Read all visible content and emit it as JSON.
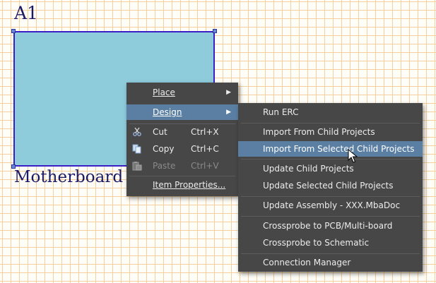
{
  "schematic": {
    "designator": "A1",
    "sheet_name": "Motherboard"
  },
  "context_menu": {
    "items": [
      {
        "label": "Place",
        "accel": "P",
        "submenu": true
      },
      {
        "label": "Design",
        "accel": "D",
        "submenu": true
      },
      {
        "label": "Cut",
        "accel": "",
        "shortcut": "Ctrl+X",
        "icon": "scissors-icon"
      },
      {
        "label": "Copy",
        "accel": "",
        "shortcut": "Ctrl+C",
        "icon": "copy-icon"
      },
      {
        "label": "Paste",
        "accel": "",
        "shortcut": "Ctrl+V",
        "icon": "paste-icon",
        "disabled": true
      },
      {
        "label": "Item Properties...",
        "accel": "I"
      }
    ]
  },
  "design_submenu": {
    "items": [
      {
        "label": "Run ERC",
        "accel": "E"
      },
      {
        "label": "Import From Child Projects",
        "accel": "I"
      },
      {
        "label": "Import From Selected Child Projects",
        "accel": "I",
        "highlighted": true
      },
      {
        "label": "Update Child Projects",
        "accel": "U"
      },
      {
        "label": "Update Selected Child Projects",
        "accel": "U"
      },
      {
        "label": "Update Assembly - XXX.MbaDoc",
        "accel": "U"
      },
      {
        "label": "Crossprobe to PCB/Multi-board",
        "accel": "P"
      },
      {
        "label": "Crossprobe to Schematic",
        "accel": "S"
      },
      {
        "label": "Connection Manager",
        "accel": "C"
      }
    ]
  },
  "colors": {
    "menu_bg": "#474747",
    "highlight": "#5b7fa3",
    "sheet_fill": "#8ecbdb",
    "sheet_border": "#3b1fc6",
    "grid": "#f3cf9c"
  }
}
